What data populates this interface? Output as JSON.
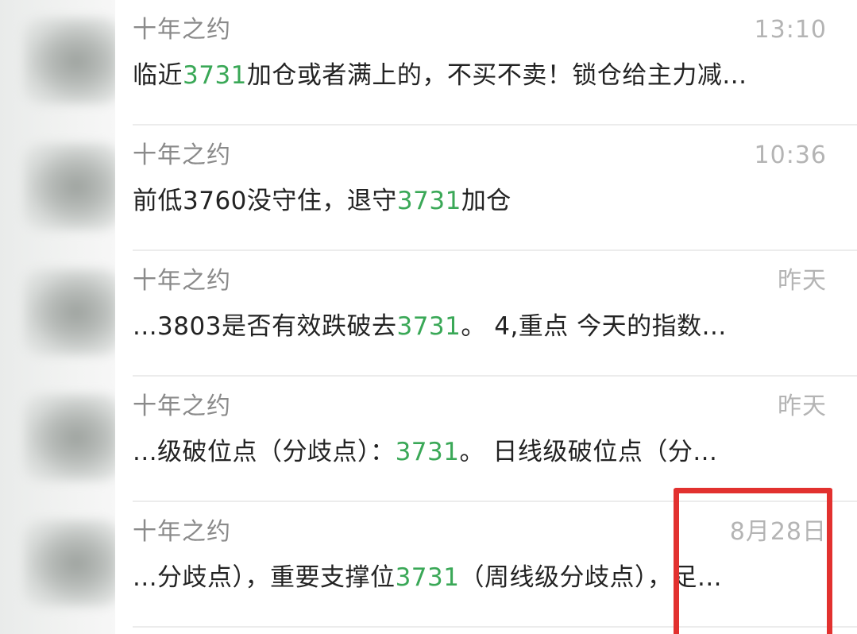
{
  "conversations": [
    {
      "name": "十年之约",
      "time": "13:10",
      "pre": "临近",
      "highlight": "3731",
      "post": "加仓或者满上的，不买不卖！锁仓给主力减..."
    },
    {
      "name": "十年之约",
      "time": "10:36",
      "pre": "前低3760没守住，退守",
      "highlight": "3731",
      "post": "加仓"
    },
    {
      "name": "十年之约",
      "time": "昨天",
      "pre": "...3803是否有效跌破去",
      "highlight": "3731",
      "post": "。 4,重点 今天的指数..."
    },
    {
      "name": "十年之约",
      "time": "昨天",
      "pre": "...级破位点（分歧点）：",
      "highlight": "3731",
      "post": "。 日线级破位点（分..."
    },
    {
      "name": "十年之约",
      "time": "8月28日",
      "pre": "...分歧点），重要支撑位",
      "highlight": "3731",
      "post": "（周线级分歧点），足..."
    }
  ],
  "colors": {
    "highlight": "#3aa857",
    "name": "#8a8a8a",
    "time": "#b4b4b4",
    "message": "#232323",
    "annotation_box": "#e2312f"
  }
}
